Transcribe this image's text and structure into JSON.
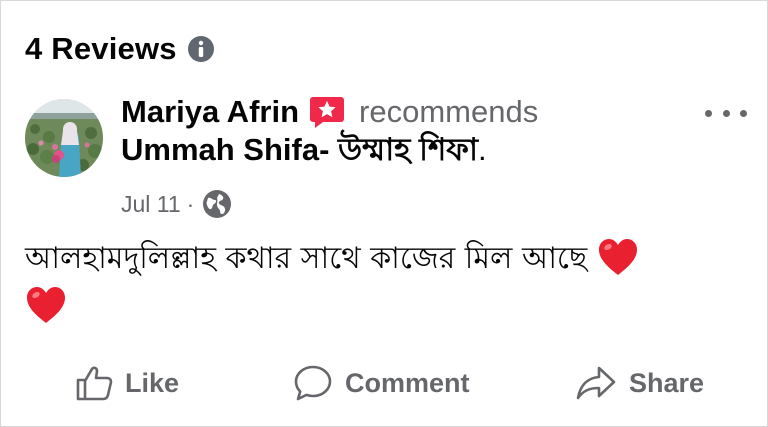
{
  "reviews": {
    "title": "4 Reviews",
    "info_icon": "info-circle-icon"
  },
  "post": {
    "author": "Mariya Afrin",
    "recommend_icon": "recommend-star-icon",
    "recommend_color": "#f02849",
    "recommends_text": "recommends",
    "page_name": "Ummah Shifa- উম্মাহ শিফা",
    "page_suffix": ".",
    "date": "Jul 11",
    "separator": "·",
    "audience_icon": "globe-icon",
    "more_icon": "more-horizontal-icon",
    "text": "আলহামদুলিল্লাহ কথার সাথে কাজের মিল আছে",
    "emoji": [
      "heart",
      "heart"
    ],
    "heart_color": "#e8202f"
  },
  "actions": {
    "like_label": "Like",
    "comment_label": "Comment",
    "share_label": "Share"
  },
  "colors": {
    "primary_text": "#050505",
    "secondary_text": "#65676b",
    "background": "#ffffff"
  }
}
